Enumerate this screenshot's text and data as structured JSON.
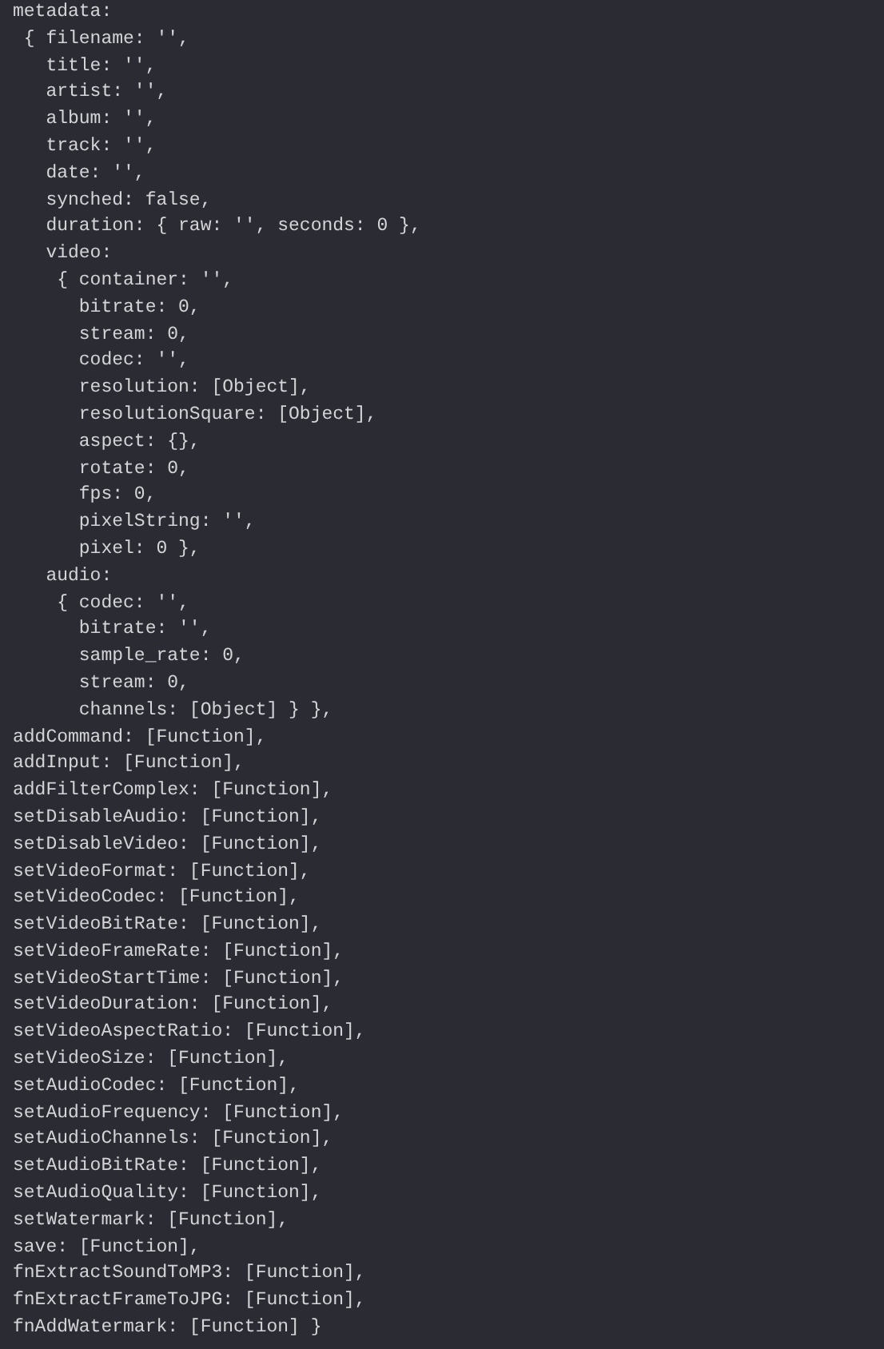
{
  "console_lines": [
    "metadata:",
    " { filename: '',",
    "   title: '',",
    "   artist: '',",
    "   album: '',",
    "   track: '',",
    "   date: '',",
    "   synched: false,",
    "   duration: { raw: '', seconds: 0 },",
    "   video:",
    "    { container: '',",
    "      bitrate: 0,",
    "      stream: 0,",
    "      codec: '',",
    "      resolution: [Object],",
    "      resolutionSquare: [Object],",
    "      aspect: {},",
    "      rotate: 0,",
    "      fps: 0,",
    "      pixelString: '',",
    "      pixel: 0 },",
    "   audio:",
    "    { codec: '',",
    "      bitrate: '',",
    "      sample_rate: 0,",
    "      stream: 0,",
    "      channels: [Object] } },",
    "addCommand: [Function],",
    "addInput: [Function],",
    "addFilterComplex: [Function],",
    "setDisableAudio: [Function],",
    "setDisableVideo: [Function],",
    "setVideoFormat: [Function],",
    "setVideoCodec: [Function],",
    "setVideoBitRate: [Function],",
    "setVideoFrameRate: [Function],",
    "setVideoStartTime: [Function],",
    "setVideoDuration: [Function],",
    "setVideoAspectRatio: [Function],",
    "setVideoSize: [Function],",
    "setAudioCodec: [Function],",
    "setAudioFrequency: [Function],",
    "setAudioChannels: [Function],",
    "setAudioBitRate: [Function],",
    "setAudioQuality: [Function],",
    "setWatermark: [Function],",
    "save: [Function],",
    "fnExtractSoundToMP3: [Function],",
    "fnExtractFrameToJPG: [Function],",
    "fnAddWatermark: [Function] }"
  ]
}
